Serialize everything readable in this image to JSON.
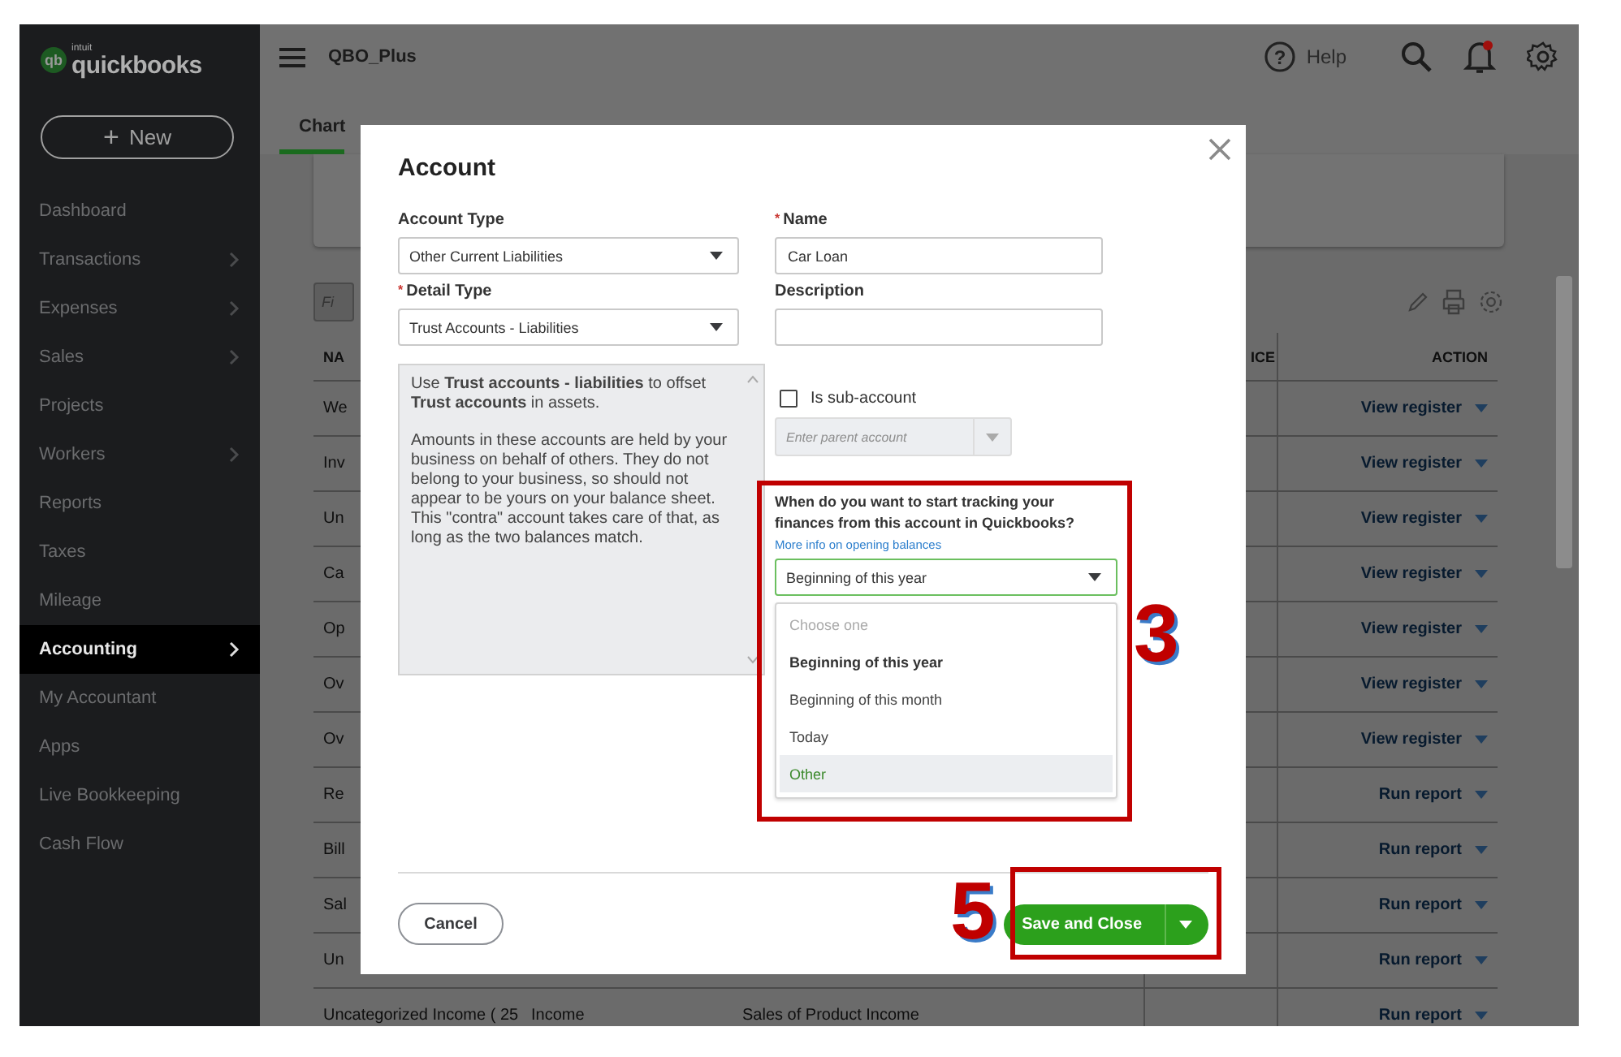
{
  "logo": {
    "mark": "qb",
    "small": "intuit",
    "name": "quickbooks"
  },
  "new_button": {
    "icon": "+",
    "label": "New"
  },
  "sidebar": {
    "items": [
      {
        "label": "Dashboard",
        "has_children": false,
        "selected": false
      },
      {
        "label": "Transactions",
        "has_children": true,
        "selected": false
      },
      {
        "label": "Expenses",
        "has_children": true,
        "selected": false
      },
      {
        "label": "Sales",
        "has_children": true,
        "selected": false
      },
      {
        "label": "Projects",
        "has_children": false,
        "selected": false
      },
      {
        "label": "Workers",
        "has_children": true,
        "selected": false
      },
      {
        "label": "Reports",
        "has_children": false,
        "selected": false
      },
      {
        "label": "Taxes",
        "has_children": false,
        "selected": false
      },
      {
        "label": "Mileage",
        "has_children": false,
        "selected": false
      },
      {
        "label": "Accounting",
        "has_children": true,
        "selected": true
      },
      {
        "label": "My Accountant",
        "has_children": false,
        "selected": false
      },
      {
        "label": "Apps",
        "has_children": false,
        "selected": false
      },
      {
        "label": "Live Bookkeeping",
        "has_children": false,
        "selected": false
      },
      {
        "label": "Cash Flow",
        "has_children": false,
        "selected": false
      }
    ]
  },
  "top_bar": {
    "company": "QBO_Plus",
    "help_icon": "?",
    "help": "Help",
    "notification_dot": true
  },
  "tabs": [
    {
      "label": "Chart",
      "selected": true
    }
  ],
  "filter": {
    "placeholder": "Fi"
  },
  "table": {
    "columns": [
      "NA",
      "",
      "",
      "",
      "ICE",
      "ACTION"
    ],
    "rows": [
      {
        "cells": [
          "We",
          "",
          "",
          "",
          "",
          "View register"
        ]
      },
      {
        "cells": [
          "Inv",
          "",
          "",
          "",
          "",
          "View register"
        ]
      },
      {
        "cells": [
          "Un",
          "",
          "",
          "",
          "",
          "View register"
        ]
      },
      {
        "cells": [
          "Ca",
          "",
          "",
          "",
          "",
          "View register"
        ]
      },
      {
        "cells": [
          "Op",
          "",
          "",
          "",
          "",
          "View register"
        ]
      },
      {
        "cells": [
          "Ov",
          "",
          "",
          "",
          "",
          "View register"
        ]
      },
      {
        "cells": [
          "Ov",
          "",
          "",
          "",
          "",
          "View register"
        ]
      },
      {
        "cells": [
          "Re",
          "",
          "",
          "",
          "",
          "Run report"
        ]
      },
      {
        "cells": [
          "Bill",
          "",
          "",
          "",
          "",
          "Run report"
        ]
      },
      {
        "cells": [
          "Sal",
          "",
          "",
          "",
          "",
          "Run report"
        ]
      },
      {
        "cells": [
          "Un",
          "",
          "",
          "",
          "",
          "Run report"
        ]
      },
      {
        "cells": [
          "Uncategorized Income ( 25",
          "Income",
          "Sales of Product Income",
          "",
          "",
          "Run report"
        ]
      }
    ]
  },
  "dialog": {
    "title": "Account",
    "required_mark": "*",
    "account_type": {
      "label": "Account Type",
      "value": "Other Current Liabilities"
    },
    "detail_type": {
      "label": "Detail Type",
      "required": true,
      "value": "Trust Accounts - Liabilities"
    },
    "info": [
      "Use **Trust accounts - liabilities** to offset **Trust accounts** in assets.",
      "Amounts in these accounts are held by your business on behalf of others. They do not belong to your business, so should not appear to be yours on your balance sheet. This \"contra\" account takes care of that, as long as the two balances match."
    ],
    "name": {
      "label": "Name",
      "required": true,
      "value": "Car Loan"
    },
    "description": {
      "label": "Description"
    },
    "sub_account": {
      "label": "Is sub-account",
      "checked": false
    },
    "parent_account": {
      "placeholder": "Enter parent account",
      "disabled": true
    },
    "tracking": {
      "question": "When do you want to start tracking your finances from this account in Quickbooks?",
      "link": "More info on opening balances",
      "value": "Beginning of this year",
      "options": [
        {
          "label": "Choose one",
          "kind": "placeholder",
          "selected": false,
          "highlighted": false
        },
        {
          "label": "Beginning of this year",
          "kind": "option",
          "selected": true,
          "highlighted": false
        },
        {
          "label": "Beginning of this month",
          "kind": "option",
          "selected": false,
          "highlighted": false
        },
        {
          "label": "Today",
          "kind": "option",
          "selected": false,
          "highlighted": false
        },
        {
          "label": "Other",
          "kind": "option",
          "selected": false,
          "highlighted": true
        }
      ]
    },
    "cancel": "Cancel",
    "save": "Save and Close"
  },
  "annotations": [
    {
      "number": "3"
    },
    {
      "number": "5"
    }
  ]
}
